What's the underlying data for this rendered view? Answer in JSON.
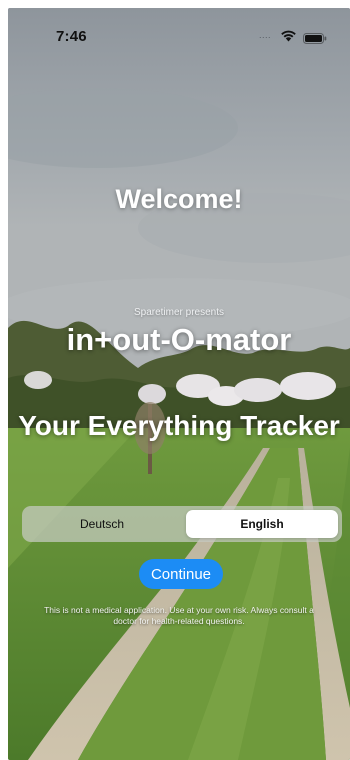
{
  "status_bar": {
    "time": "7:46",
    "signal_icon": "....",
    "wifi_icon": "wifi-icon",
    "battery_icon": "battery-icon"
  },
  "welcome": {
    "heading": "Welcome!",
    "presenter": "Sparetimer presents",
    "app_name": "in+out-O-mator",
    "tagline": "Your Everything Tracker"
  },
  "language_picker": {
    "options": [
      "Deutsch",
      "English"
    ],
    "selected": "English"
  },
  "continue_button": {
    "label": "Continue",
    "color": "#1c8cf5"
  },
  "disclaimer": "This is not a medical application. Use at your own risk. Always consult a doctor for health-related questions."
}
